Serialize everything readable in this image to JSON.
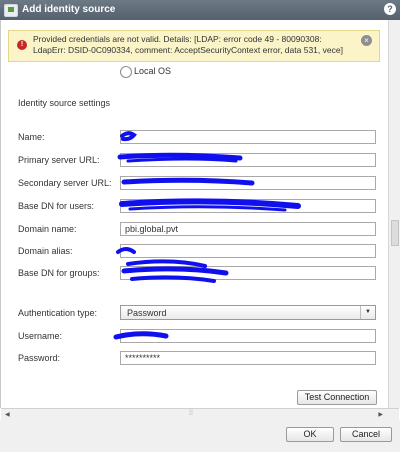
{
  "window": {
    "title": "Add identity source",
    "help_label": "?"
  },
  "error": {
    "message": "Provided credentials are not valid. Details: [LDAP: error code 49 - 80090308: LdapErr: DSID-0C090334, comment: AcceptSecurityContext error, data 531, vece]"
  },
  "source_option": {
    "label": "Local OS"
  },
  "section_title": "Identity source settings",
  "form": {
    "name_label": "Name:",
    "primary_url_label": "Primary server URL:",
    "secondary_url_label": "Secondary server URL:",
    "base_dn_users_label": "Base DN for users:",
    "domain_name_label": "Domain name:",
    "domain_name_value": "pbi.global.pvt",
    "domain_alias_label": "Domain alias:",
    "base_dn_groups_label": "Base DN for groups:",
    "auth_type_label": "Authentication type:",
    "auth_type_value": "Password",
    "username_label": "Username:",
    "password_label": "Password:",
    "password_value": "**********"
  },
  "buttons": {
    "test_connection": "Test Connection",
    "ok": "OK",
    "cancel": "Cancel"
  },
  "colors": {
    "redaction": "#1010ee",
    "error_bg": "#fbf4c9",
    "title_bar": "#5f6b76"
  }
}
